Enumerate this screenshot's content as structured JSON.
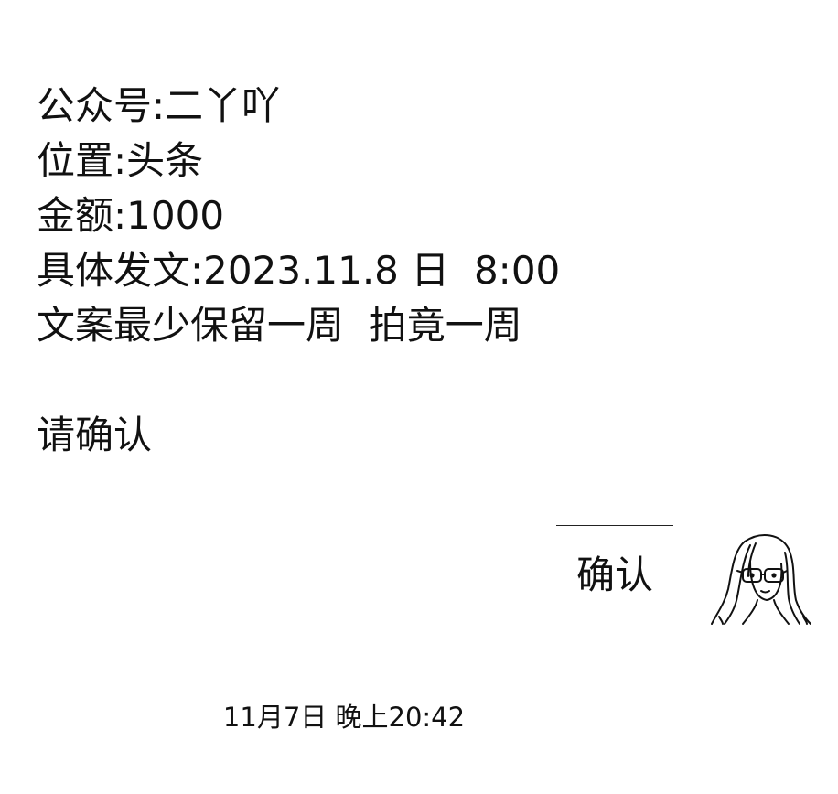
{
  "message": {
    "lines": [
      "公众号:二丫吖",
      "位置:头条",
      "金额:1000",
      "具体发文:2023.11.8 日  8:00",
      "文案最少保留一周  拍竟一周"
    ],
    "confirm_prompt": "请确认"
  },
  "reply": {
    "text": "确认",
    "avatar_icon": "girl-with-glasses-avatar-icon"
  },
  "timestamp": "11月7日 晚上20:42"
}
